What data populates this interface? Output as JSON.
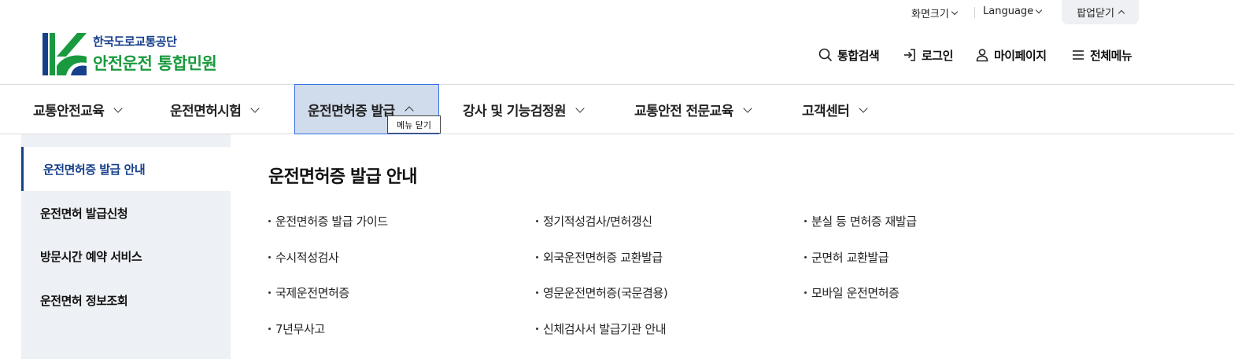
{
  "util": {
    "screen_size_label": "화면크기",
    "language_label": "Language",
    "popup_close_label": "팝업닫기"
  },
  "logo": {
    "org": "한국도로교통공단",
    "service": "안전운전 통합민원"
  },
  "header_nav": {
    "search_label": "통합검색",
    "login_label": "로그인",
    "mypage_label": "마이페이지",
    "allmenu_label": "전체메뉴"
  },
  "gnb": {
    "items": [
      {
        "label": "교통안전교육"
      },
      {
        "label": "운전면허시험"
      },
      {
        "label": "운전면허증 발급"
      },
      {
        "label": "강사 및 기능검정원"
      },
      {
        "label": "교통안전 전문교육"
      },
      {
        "label": "고객센터"
      }
    ],
    "active_index": 2,
    "tooltip": "메뉴 닫기"
  },
  "side_menu": {
    "items": [
      {
        "label": "운전면허증 발급 안내"
      },
      {
        "label": "운전면허 발급신청"
      },
      {
        "label": "방문시간 예약 서비스"
      },
      {
        "label": "운전면허 정보조회"
      }
    ],
    "active_index": 0
  },
  "content": {
    "title": "운전면허증 발급 안내",
    "links": [
      "운전면허증 발급 가이드",
      "정기적성검사/면허갱신",
      "분실 등 면허증 재발급",
      "수시적성검사",
      "외국운전면허증 교환발급",
      "군면허 교환발급",
      "국제운전면허증",
      "영문운전면허증(국문겸용)",
      "모바일 운전면허증",
      "7년무사고",
      "신체검사서 발급기관 안내"
    ]
  },
  "colors": {
    "brand_blue": "#17408b",
    "brand_green": "#1a9a3e",
    "active_tab_bg": "#d0dceb",
    "active_tab_border": "#3370e6",
    "side_bg": "#edf0f4"
  }
}
